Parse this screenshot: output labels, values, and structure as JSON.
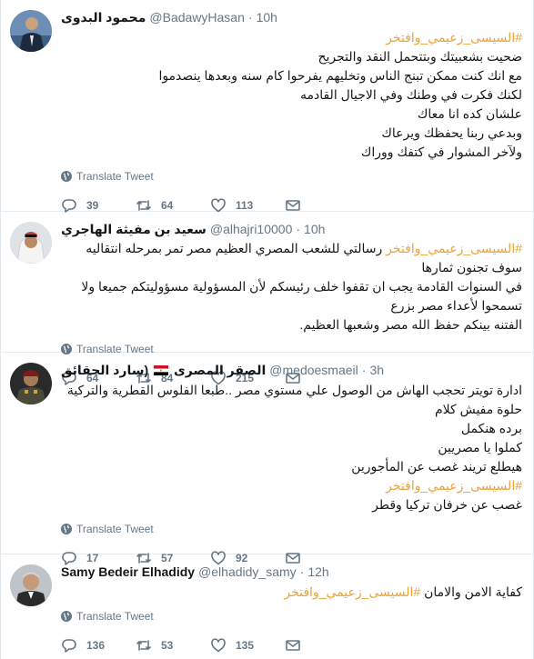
{
  "translate_label": "Translate Tweet",
  "tweets": [
    {
      "name": "محمود البدوى",
      "handle": "@BadawyHasan",
      "time": "10h",
      "hashtag": "#السيسى_زعيمي_وافتخر",
      "lines": [
        "ضحيت بشعبيتك وبتتحمل النقد والتجريح",
        "مع انك كنت ممكن تبنج الناس وتخليهم يفرحوا كام سنه وبعدها ينصدموا",
        "لكنك فكرت في وطنك وفي الاجيال القادمه",
        "علشان كده انا معاك",
        "وبدعي ربنا يحفظك ويرعاك",
        "ولآخر المشوار في كتفك ووراك"
      ],
      "replies": "39",
      "retweets": "64",
      "likes": "113"
    },
    {
      "name": "سعيد بن مفيثة الهاجري",
      "handle": "@alhajri10000",
      "time": "10h",
      "hashtag": "#السيسى_زعيمي_وافتخر",
      "first_line_rest": "رسالتي للشعب المصري العظيم مصر تمر بمرحله انتقاليه سوف تجنون ثمارها",
      "lines": [
        "في السنوات القادمة يجب ان تقفوا خلف رئيسكم لأن المسؤولية مسؤوليتكم جميعا ولا تسمحوا لأعداء مصر بزرع",
        "الفتنه بينكم حفظ الله مصر وشعبها العظيم."
      ],
      "replies": "64",
      "retweets": "84",
      "likes": "215"
    },
    {
      "name": "الصقر المصرى",
      "name_suffix": "(سارد الحقائق",
      "handle": "@medoesmaeil",
      "time": "3h",
      "lines_before": [
        "ادارة تويتر تحجب الهاش من الوصول علي مستوي مصر ..طبعا الفلوس القطرية والتركية حلوة مفيش كلام",
        "برده هنكمل",
        "كملوا يا مصريين",
        "هيطلع تريند غصب عن المأجورين"
      ],
      "hashtag": "#السيسى_زعيمي_وافتخر",
      "lines_after": [
        "غصب عن خرفان تركيا وقطر"
      ],
      "replies": "17",
      "retweets": "57",
      "likes": "92"
    },
    {
      "name": "Samy Bedeir Elhadidy",
      "handle": "@elhadidy_samy",
      "time": "12h",
      "line": "كفاية الامن والامان",
      "hashtag": "#السيسى_زعيمي_وافتخر",
      "replies": "136",
      "retweets": "53",
      "likes": "135"
    }
  ]
}
